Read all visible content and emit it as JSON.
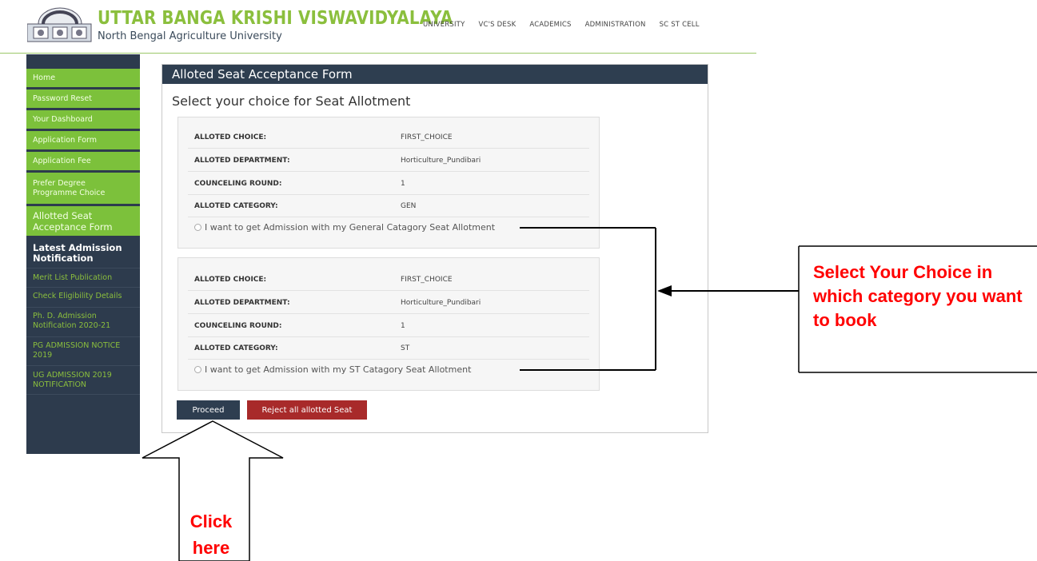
{
  "header": {
    "title": "UTTAR BANGA KRISHI VISWAVIDYALAYA",
    "subtitle": "North Bengal Agriculture University",
    "nav": [
      "UNIVERSITY",
      "VC'S DESK",
      "ACADEMICS",
      "ADMINISTRATION",
      "SC ST CELL"
    ]
  },
  "sidebar": {
    "items": [
      "Home",
      "Password Reset",
      "Your Dashboard",
      "Application Form",
      "Application Fee",
      "Prefer Degree Programme Choice",
      "Allotted Seat Acceptance Form"
    ],
    "notification_heading": "Latest Admission Notification",
    "links": [
      "Merit List Publication",
      "Check Eligibility Details",
      "Ph. D. Admission Notification 2020-21",
      "PG ADMISSION NOTICE 2019",
      "UG ADMISSION 2019 NOTIFICATION"
    ]
  },
  "form": {
    "title": "Alloted Seat Acceptance Form",
    "subtitle": "Select your choice for Seat Allotment",
    "cards": [
      {
        "rows": [
          {
            "label": "ALLOTED CHOICE:",
            "value": "FIRST_CHOICE"
          },
          {
            "label": "ALLOTED DEPARTMENT:",
            "value": "Horticulture_Pundibari"
          },
          {
            "label": "COUNCELING ROUND:",
            "value": "1"
          },
          {
            "label": "ALLOTED CATEGORY:",
            "value": "GEN"
          }
        ],
        "option": "I want to get Admission with my General Catagory Seat Allotment"
      },
      {
        "rows": [
          {
            "label": "ALLOTED CHOICE:",
            "value": "FIRST_CHOICE"
          },
          {
            "label": "ALLOTED DEPARTMENT:",
            "value": "Horticulture_Pundibari"
          },
          {
            "label": "COUNCELING ROUND:",
            "value": "1"
          },
          {
            "label": "ALLOTED CATEGORY:",
            "value": "ST"
          }
        ],
        "option": "I want to get Admission with my ST Catagory Seat Allotment"
      }
    ],
    "proceed_label": "Proceed",
    "reject_label": "Reject all allotted Seat"
  },
  "annotations": {
    "callout": "Select Your Choice in which category you want to book",
    "click": "Click here"
  },
  "colors": {
    "brand_green": "#8bbf3d",
    "sidebar_dark": "#2d3b4d",
    "reject_red": "#a82a2a",
    "annotation_red": "#ff0000"
  }
}
